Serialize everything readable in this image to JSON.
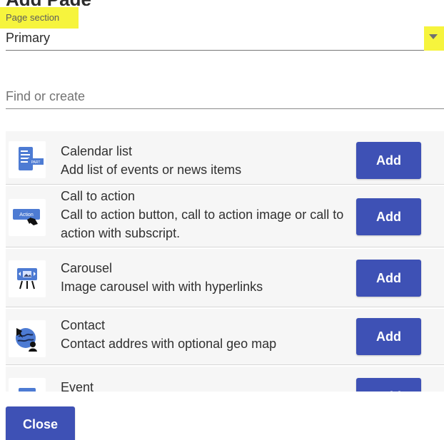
{
  "page": {
    "partial_heading": "Add Page Segment"
  },
  "section_select": {
    "label": "Page section",
    "value": "Primary"
  },
  "search": {
    "placeholder": "Find or create",
    "value": ""
  },
  "list": {
    "items": [
      {
        "title": "Calendar list",
        "description": "Add list of events or news items",
        "icon": "calendar-list-icon",
        "button_label": "Add"
      },
      {
        "title": "Call to action",
        "description": "Call to action button, call to action image or call to action with subscript.",
        "icon": "call-to-action-icon",
        "icon_text": "Action",
        "button_label": "Add"
      },
      {
        "title": "Carousel",
        "description": "Image carousel with with hyperlinks",
        "icon": "carousel-icon",
        "button_label": "Add"
      },
      {
        "title": "Contact",
        "description": "Contact addres with optional geo map",
        "icon": "contact-icon",
        "button_label": "Add"
      },
      {
        "title": "Event",
        "description": "",
        "icon": "event-icon",
        "button_label": "Add"
      }
    ]
  },
  "footer": {
    "close_label": "Close"
  },
  "colors": {
    "accent": "#3e51b5",
    "highlight": "#f6f43d",
    "row_background": "#f6f6f6",
    "divider": "#d7d7d7"
  }
}
